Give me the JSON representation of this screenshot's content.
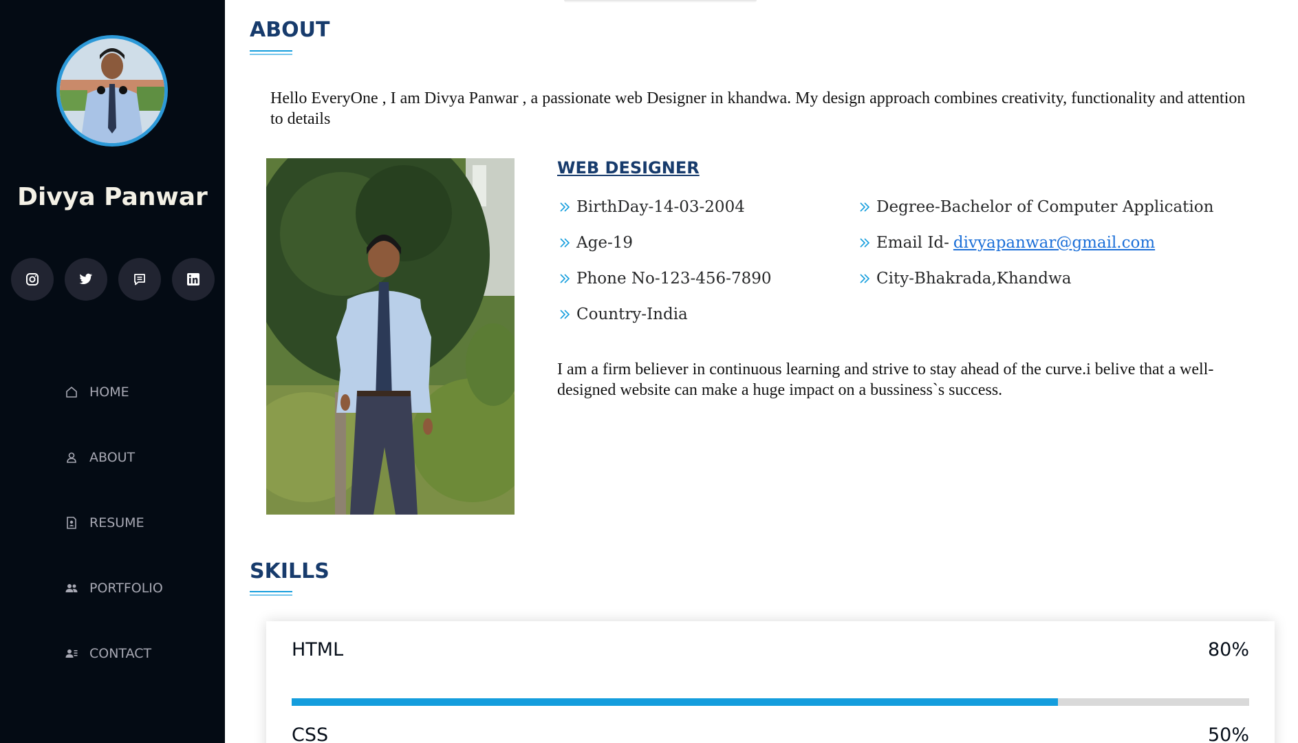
{
  "profile": {
    "name": "Divya Panwar",
    "avatar_icon": "profile-photo"
  },
  "social": [
    {
      "icon": "instagram-icon",
      "label": "Instagram"
    },
    {
      "icon": "twitter-icon",
      "label": "Twitter"
    },
    {
      "icon": "message-icon",
      "label": "Message"
    },
    {
      "icon": "linkedin-icon",
      "label": "LinkedIn"
    }
  ],
  "nav": [
    {
      "label": "HOME",
      "icon": "home-icon"
    },
    {
      "label": "ABOUT",
      "icon": "user-icon"
    },
    {
      "label": "RESUME",
      "icon": "file-person-icon"
    },
    {
      "label": "PORTFOLIO",
      "icon": "people-icon"
    },
    {
      "label": "CONTACT",
      "icon": "contact-card-icon"
    }
  ],
  "about": {
    "title": "ABOUT",
    "intro": "Hello EveryOne , I am Divya Panwar , a passionate web Designer in khandwa. My design approach combines creativity, functionality and attention to details",
    "role": "WEB DESIGNER",
    "info_left": [
      "BirthDay-14-03-2004",
      "Age-19",
      "Phone No-123-456-7890",
      "Country-India"
    ],
    "info_right": [
      "Degree-Bachelor of Computer Application",
      "Email Id-",
      "City-Bhakrada,Khandwa"
    ],
    "email": "divyapanwar@gmail.com",
    "belief": "I am a firm believer in continuous learning and strive to stay ahead of the curve.i belive that a well-designed website can make a huge impact on a bussiness`s success."
  },
  "skills": {
    "title": "SKILLS",
    "items": [
      {
        "name": "HTML",
        "value": "80%",
        "fraction": 0.8
      },
      {
        "name": "CSS",
        "value": "50%",
        "fraction": 0.5
      }
    ]
  },
  "colors": {
    "sidebar_bg": "#040b14",
    "accent": "#149ddd",
    "heading": "#173b6c"
  }
}
